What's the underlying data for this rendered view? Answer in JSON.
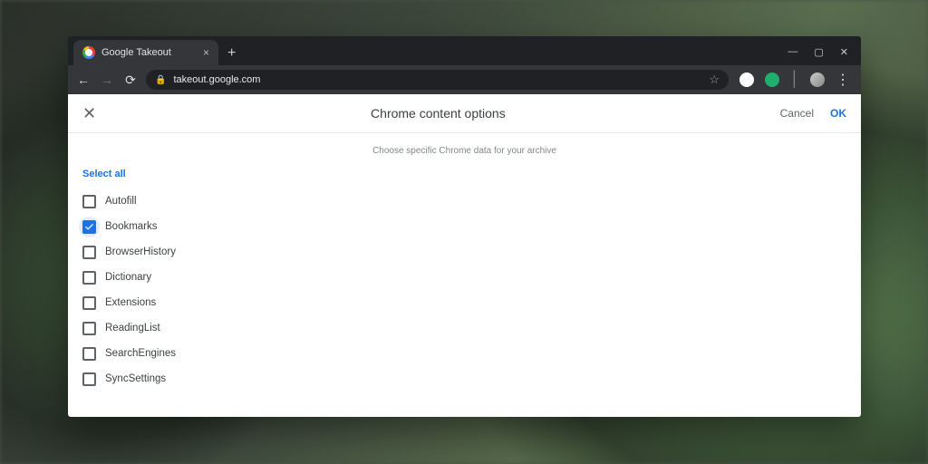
{
  "browser": {
    "tab_title": "Google Takeout",
    "url": "takeout.google.com"
  },
  "dialog": {
    "title": "Chrome content options",
    "subtitle": "Choose specific Chrome data for your archive",
    "cancel_label": "Cancel",
    "ok_label": "OK",
    "select_all_label": "Select all"
  },
  "options": [
    {
      "label": "Autofill",
      "checked": false
    },
    {
      "label": "Bookmarks",
      "checked": true
    },
    {
      "label": "BrowserHistory",
      "checked": false
    },
    {
      "label": "Dictionary",
      "checked": false
    },
    {
      "label": "Extensions",
      "checked": false
    },
    {
      "label": "ReadingList",
      "checked": false
    },
    {
      "label": "SearchEngines",
      "checked": false
    },
    {
      "label": "SyncSettings",
      "checked": false
    }
  ]
}
